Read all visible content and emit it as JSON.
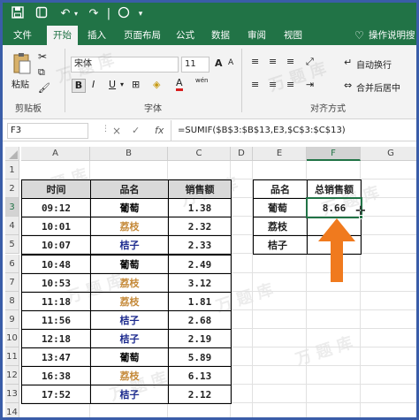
{
  "ribbon": {
    "tabs": [
      "文件",
      "开始",
      "插入",
      "页面布局",
      "公式",
      "数据",
      "审阅",
      "视图"
    ],
    "tell_me": "操作说明搜",
    "font_name": "宋体",
    "font_size": "11",
    "paste_label": "粘贴",
    "groups": {
      "clipboard": "剪贴板",
      "font": "字体",
      "alignment": "对齐方式"
    },
    "wrap_text": "自动换行",
    "merge_center": "合并后居中",
    "bold": "B",
    "italic": "I",
    "underline": "U",
    "font_color_letter": "A",
    "font_grow": "A",
    "font_shrink": "A",
    "phonetic_letter": "wén"
  },
  "formula_bar": {
    "name_box": "F3",
    "cancel": "×",
    "enter": "✓",
    "fx": "fx",
    "formula": "=SUMIF($B$3:$B$13,E3,$C$3:$C$13)"
  },
  "columns": [
    "A",
    "B",
    "C",
    "D",
    "E",
    "F",
    "G"
  ],
  "rows": [
    "1",
    "2",
    "3",
    "4",
    "5",
    "6",
    "7",
    "8",
    "9",
    "10",
    "11",
    "12",
    "13",
    "14"
  ],
  "main_table": {
    "headers": [
      "时间",
      "品名",
      "销售额"
    ],
    "rows": [
      {
        "time": "09:12",
        "name": "葡萄",
        "amount": "1.38",
        "color": "#000000"
      },
      {
        "time": "10:01",
        "name": "荔枝",
        "amount": "2.32",
        "color": "#c58a3a"
      },
      {
        "time": "10:07",
        "name": "桔子",
        "amount": "2.33",
        "color": "#1c2a8e"
      },
      {
        "time": "10:48",
        "name": "葡萄",
        "amount": "2.49",
        "color": "#000000"
      },
      {
        "time": "10:53",
        "name": "荔枝",
        "amount": "3.12",
        "color": "#c58a3a"
      },
      {
        "time": "11:18",
        "name": "荔枝",
        "amount": "1.81",
        "color": "#c58a3a"
      },
      {
        "time": "11:56",
        "name": "桔子",
        "amount": "2.68",
        "color": "#1c2a8e"
      },
      {
        "time": "12:18",
        "name": "桔子",
        "amount": "2.19",
        "color": "#1c2a8e"
      },
      {
        "time": "13:47",
        "name": "葡萄",
        "amount": "5.89",
        "color": "#000000"
      },
      {
        "time": "16:38",
        "name": "荔枝",
        "amount": "6.13",
        "color": "#c58a3a"
      },
      {
        "time": "17:52",
        "name": "桔子",
        "amount": "2.12",
        "color": "#1c2a8e"
      }
    ]
  },
  "summary_table": {
    "headers": [
      "品名",
      "总销售额"
    ],
    "rows": [
      {
        "name": "葡萄",
        "total": "8.66"
      },
      {
        "name": "荔枝",
        "total": ""
      },
      {
        "name": "桔子",
        "total": ""
      }
    ]
  },
  "colors": {
    "excel_green": "#217346",
    "arrow": "#f07a1e",
    "selection": "#217346"
  }
}
